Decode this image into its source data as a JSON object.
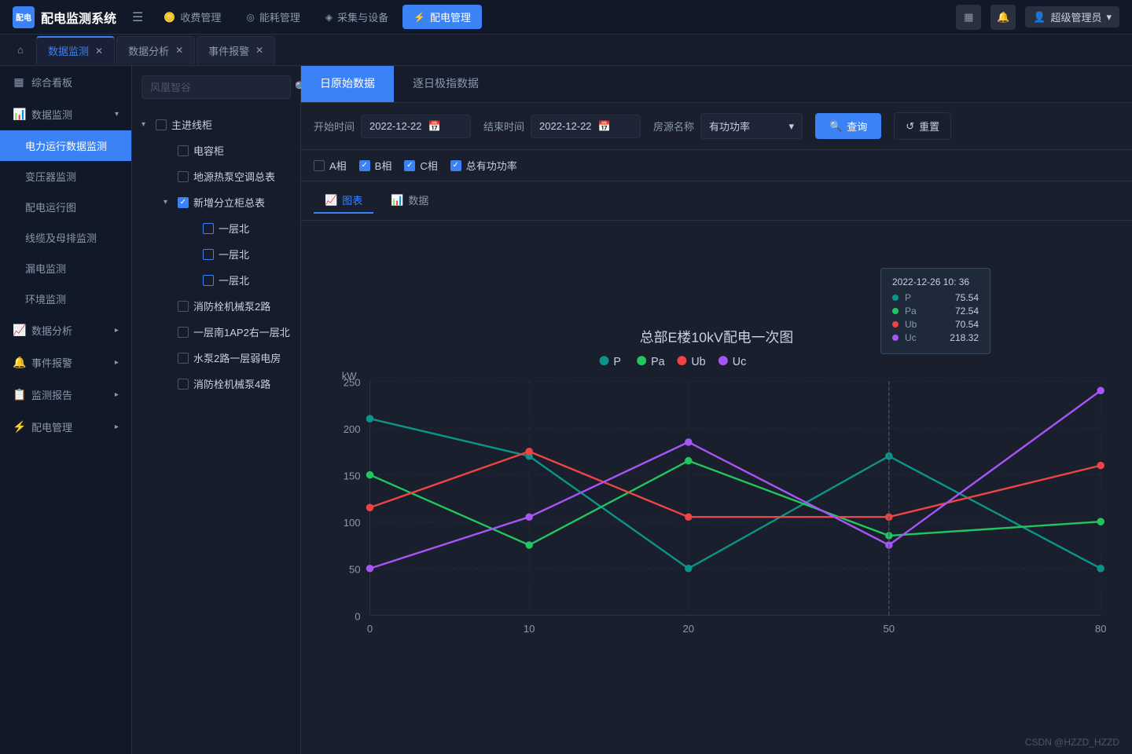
{
  "app": {
    "logo": "配电监测系统",
    "logo_short": "配电"
  },
  "top_nav": {
    "menu_icon": "☰",
    "items": [
      {
        "id": "fees",
        "icon": "🪙",
        "label": "收费管理",
        "active": false
      },
      {
        "id": "energy",
        "icon": "⊕",
        "label": "能耗管理",
        "active": false
      },
      {
        "id": "collect",
        "icon": "⚙",
        "label": "采集与设备",
        "active": false
      },
      {
        "id": "power",
        "icon": "⚡",
        "label": "配电管理",
        "active": true
      }
    ],
    "right": {
      "grid_icon": "▦",
      "bell_icon": "🔔",
      "user_icon": "👤",
      "username": "超级管理员",
      "dropdown_icon": "▾"
    }
  },
  "tabs_row": {
    "home_icon": "⌂",
    "tabs": [
      {
        "id": "monitor",
        "label": "数据监测",
        "active": true
      },
      {
        "id": "analysis",
        "label": "数据分析",
        "active": false
      },
      {
        "id": "alerts",
        "label": "事件报警",
        "active": false
      }
    ]
  },
  "sidebar": {
    "items": [
      {
        "id": "overview",
        "icon": "▦",
        "label": "综合看板",
        "active": false,
        "group": false
      },
      {
        "id": "data-monitor",
        "icon": "📊",
        "label": "数据监测",
        "active": false,
        "group": true,
        "open": true,
        "children": [
          {
            "id": "power-monitor",
            "label": "电力运行数据监测",
            "active": true
          },
          {
            "id": "transformer",
            "label": "变压器监测",
            "active": false
          },
          {
            "id": "power-diagram",
            "label": "配电运行图",
            "active": false
          },
          {
            "id": "cable-monitor",
            "label": "线缆及母排监测",
            "active": false
          },
          {
            "id": "leakage",
            "label": "漏电监测",
            "active": false
          },
          {
            "id": "environment",
            "label": "环境监测",
            "active": false
          }
        ]
      },
      {
        "id": "data-analysis",
        "icon": "📈",
        "label": "数据分析",
        "active": false,
        "group": true,
        "open": false
      },
      {
        "id": "event-alert",
        "icon": "🔔",
        "label": "事件报警",
        "active": false,
        "group": true,
        "open": false
      },
      {
        "id": "monitor-report",
        "icon": "📋",
        "label": "监测报告",
        "active": false,
        "group": true,
        "open": false
      },
      {
        "id": "power-mgmt",
        "icon": "⚡",
        "label": "配电管理",
        "active": false,
        "group": true,
        "open": false
      }
    ]
  },
  "tree": {
    "search_placeholder": "风凰智谷",
    "nodes": [
      {
        "id": "main-line",
        "label": "主进线柜",
        "open": true,
        "checked": false,
        "children": [
          {
            "id": "capacitor",
            "label": "电容柜",
            "checked": false,
            "children": []
          },
          {
            "id": "heatpump",
            "label": "地源热泵空调总表",
            "checked": false,
            "children": []
          },
          {
            "id": "new-cabinet",
            "label": "新增分立柜总表",
            "open": true,
            "checked": true,
            "children": [
              {
                "id": "floor1-north-1",
                "label": "一层北",
                "checked": false
              },
              {
                "id": "floor1-north-2",
                "label": "一层北",
                "checked": false
              },
              {
                "id": "floor1-north-3",
                "label": "一层北",
                "checked": false
              }
            ]
          },
          {
            "id": "fire-pump2",
            "label": "消防栓机械泵2路",
            "checked": false
          },
          {
            "id": "floor1-south",
            "label": "一层南1AP2右一层北",
            "checked": false
          },
          {
            "id": "water-pump",
            "label": "水泵2路一层弱电房",
            "checked": false
          },
          {
            "id": "fire-pump4",
            "label": "消防栓机械泵4路",
            "checked": false
          }
        ]
      }
    ]
  },
  "chart_panel": {
    "main_tabs": [
      {
        "id": "raw",
        "label": "日原始数据",
        "active": true
      },
      {
        "id": "daily",
        "label": "逐日极指数据",
        "active": false
      }
    ],
    "controls": {
      "start_label": "开始时间",
      "start_value": "2022-12-22",
      "end_label": "结束时间",
      "end_value": "2022-12-22",
      "room_label": "房源名称",
      "room_value": "有功功率",
      "query_btn": "查询",
      "reset_btn": "重置"
    },
    "checkboxes": [
      {
        "id": "a-phase",
        "label": "A相",
        "checked": false,
        "color": "#8899aa"
      },
      {
        "id": "b-phase",
        "label": "B相",
        "checked": true,
        "color": "#3b82f6"
      },
      {
        "id": "c-phase",
        "label": "C相",
        "checked": true,
        "color": "#3b82f6"
      },
      {
        "id": "total",
        "label": "总有功功率",
        "checked": true,
        "color": "#3b82f6"
      }
    ],
    "view_tabs": [
      {
        "id": "chart",
        "label": "图表",
        "active": true
      },
      {
        "id": "data",
        "label": "数据",
        "active": false
      }
    ],
    "chart": {
      "title": "总部E楼10kV配电一次图",
      "y_label": "kW",
      "y_values": [
        0,
        50,
        100,
        150,
        200,
        250
      ],
      "x_values": [
        0,
        10,
        20,
        50,
        80
      ],
      "legend": [
        {
          "id": "P",
          "color": "#0d9488"
        },
        {
          "id": "Pa",
          "color": "#22c55e"
        },
        {
          "id": "Ub",
          "color": "#ef4444"
        },
        {
          "id": "Uc",
          "color": "#a855f7"
        }
      ],
      "tooltip": {
        "time": "2022-12-26 10: 36",
        "rows": [
          {
            "key": "P",
            "value": "75.54",
            "color": "#0d9488"
          },
          {
            "key": "Pa",
            "value": "72.54",
            "color": "#22c55e"
          },
          {
            "key": "Ub",
            "value": "70.54",
            "color": "#ef4444"
          },
          {
            "key": "Uc",
            "value": "218.32",
            "color": "#a855f7"
          }
        ]
      }
    }
  },
  "footer": "CSDN @HZZD_HZZD"
}
